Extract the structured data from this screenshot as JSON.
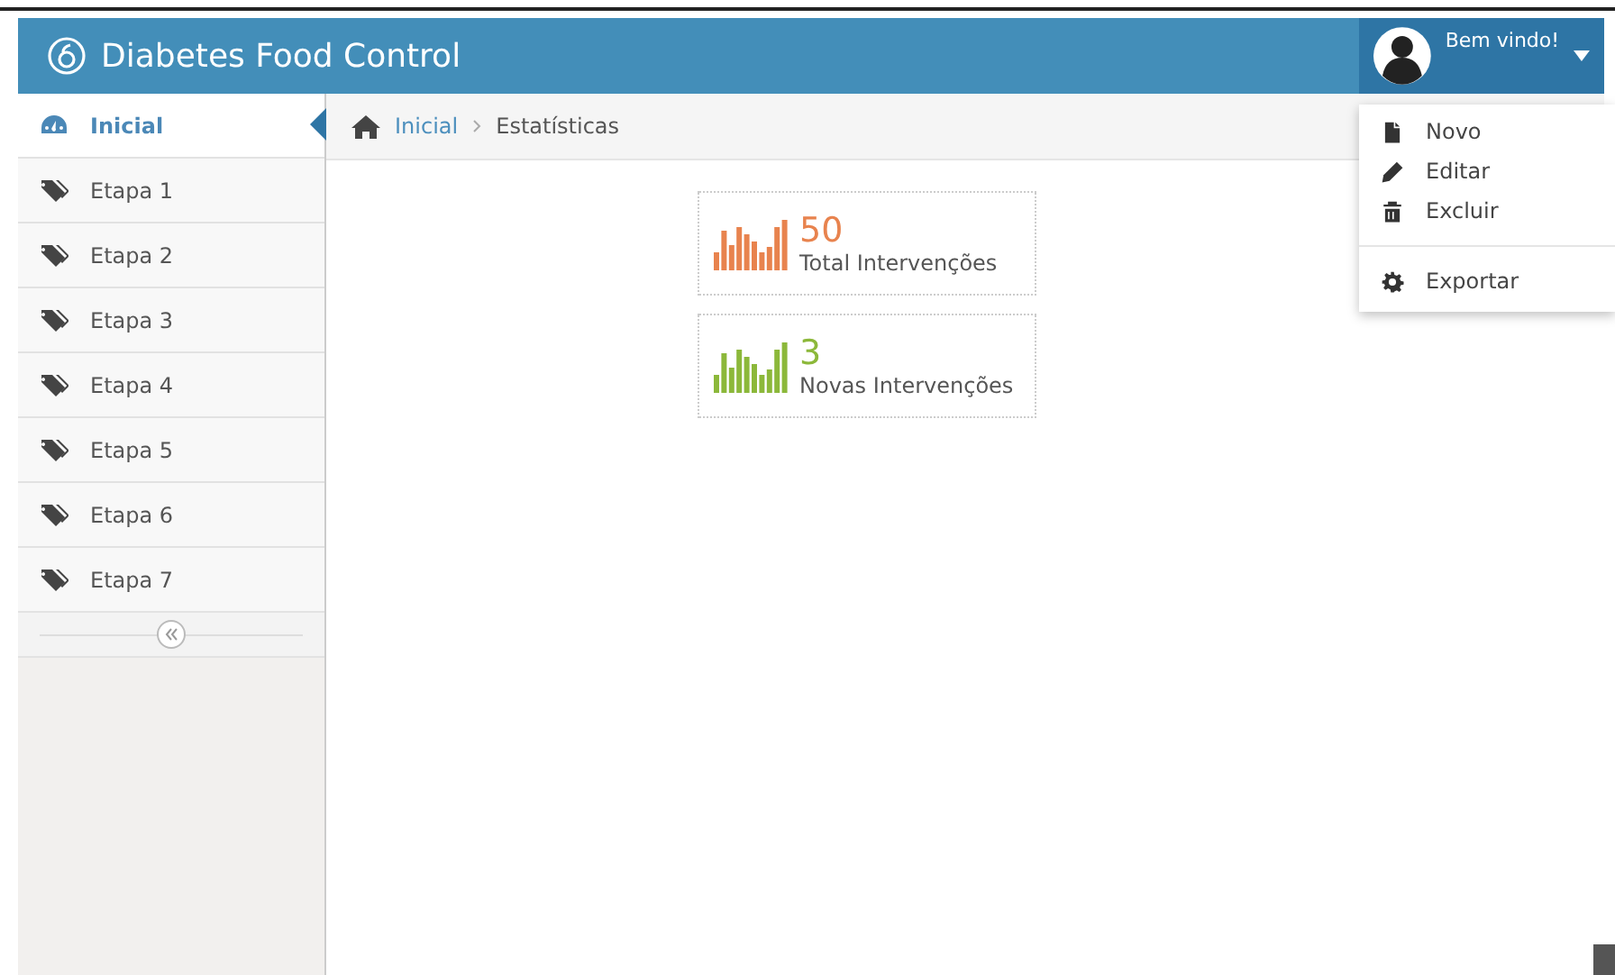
{
  "header": {
    "title": "Diabetes Food Control",
    "user": {
      "greeting": "Bem vindo!",
      "menu_open": true
    }
  },
  "user_menu": [
    {
      "kind": "file",
      "label": "Novo"
    },
    {
      "kind": "pencil",
      "label": "Editar"
    },
    {
      "kind": "trash",
      "label": "Excluir"
    },
    {
      "kind": "gear",
      "label": "Exportar",
      "divider_before": true
    }
  ],
  "sidebar": {
    "items": [
      {
        "label": "Inicial",
        "kind": "dashboard",
        "selected": true
      },
      {
        "label": "Etapa 1",
        "kind": "tags",
        "selected": false
      },
      {
        "label": "Etapa 2",
        "kind": "tags",
        "selected": false
      },
      {
        "label": "Etapa 3",
        "kind": "tags",
        "selected": false
      },
      {
        "label": "Etapa 4",
        "kind": "tags",
        "selected": false
      },
      {
        "label": "Etapa 5",
        "kind": "tags",
        "selected": false
      },
      {
        "label": "Etapa 6",
        "kind": "tags",
        "selected": false
      },
      {
        "label": "Etapa 7",
        "kind": "tags",
        "selected": false
      }
    ]
  },
  "breadcrumb": [
    {
      "label": "Inicial",
      "link": true
    },
    {
      "label": "Estatísticas",
      "link": false
    }
  ],
  "stats": [
    {
      "value": "50",
      "label": "Total Intervenções",
      "color": "#e8834e"
    },
    {
      "value": "3",
      "label": "Novas Intervenções",
      "color": "#8cb83a"
    }
  ]
}
